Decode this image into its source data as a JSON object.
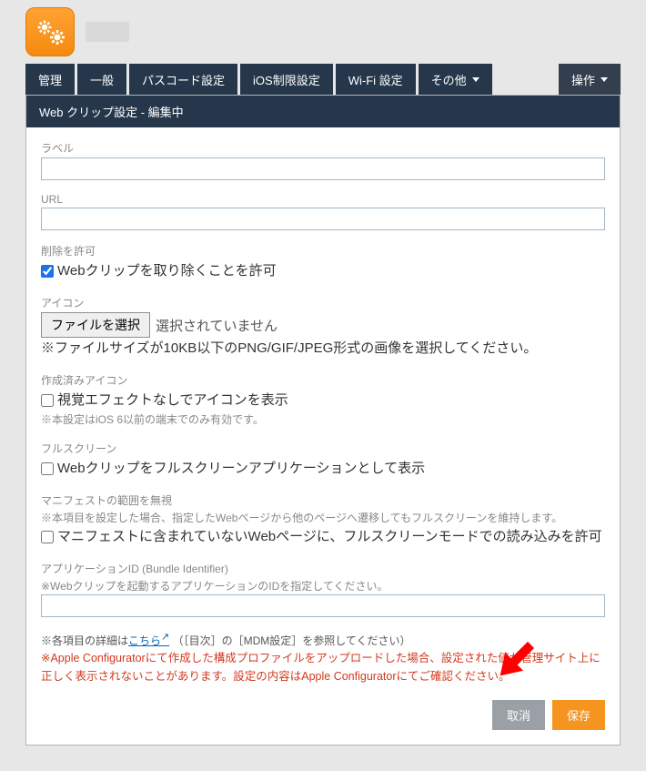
{
  "header": {
    "title_redacted": true
  },
  "tabs": {
    "items": [
      {
        "label": "管理"
      },
      {
        "label": "一般"
      },
      {
        "label": "パスコード設定"
      },
      {
        "label": "iOS制限設定"
      },
      {
        "label": "Wi-Fi 設定"
      },
      {
        "label": "その他",
        "dropdown": true
      }
    ],
    "action": {
      "label": "操作",
      "dropdown": true
    }
  },
  "panel": {
    "title": "Web クリップ設定 - 編集中",
    "fields": {
      "label": {
        "label": "ラベル",
        "value": ""
      },
      "url": {
        "label": "URL",
        "value": ""
      },
      "allow_remove": {
        "label": "削除を許可",
        "checkbox_label": "Webクリップを取り除くことを許可",
        "checked": true
      },
      "icon": {
        "label": "アイコン",
        "file_button": "ファイルを選択",
        "file_status": "選択されていません",
        "help": "※ファイルサイズが10KB以下のPNG/GIF/JPEG形式の画像を選択してください。"
      },
      "precomposed": {
        "label": "作成済みアイコン",
        "checkbox_label": "視覚エフェクトなしでアイコンを表示",
        "checked": false,
        "help": "※本設定はiOS 6以前の端末でのみ有効です。"
      },
      "fullscreen": {
        "label": "フルスクリーン",
        "checkbox_label": "Webクリップをフルスクリーンアプリケーションとして表示",
        "checked": false
      },
      "ignore_manifest": {
        "label": "マニフェストの範囲を無視",
        "help": "※本項目を設定した場合、指定したWebページから他のページへ遷移してもフルスクリーンを維持します。",
        "checkbox_label": "マニフェストに含まれていないWebページに、フルスクリーンモードでの読み込みを許可",
        "checked": false
      },
      "bundle_id": {
        "label": "アプリケーションID (Bundle Identifier)",
        "help": "※Webクリップを起動するアプリケーションのIDを指定してください。",
        "value": ""
      }
    },
    "footer": {
      "note_prefix": "※各項目の詳細は",
      "link_text": "こちら",
      "note_suffix": "（［目次］の［MDM設定］を参照してください）",
      "warning": "※Apple Configuratorにて作成した構成プロファイルをアップロードした場合、設定された値が管理サイト上に正しく表示されないことがあります。設定の内容はApple Configuratorにてご確認ください。"
    },
    "buttons": {
      "cancel": "取消",
      "save": "保存"
    }
  },
  "annotation": {
    "arrow_color": "#ff0000"
  }
}
